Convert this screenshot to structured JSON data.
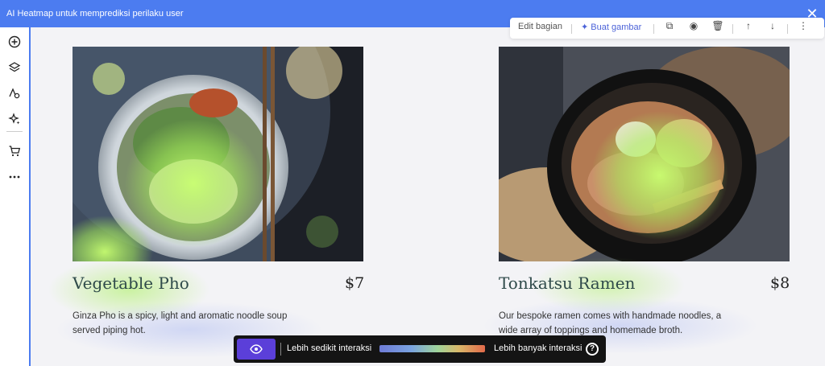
{
  "topbar": {
    "title": "AI Heatmap untuk memprediksi perilaku user",
    "close_icon": "close-icon"
  },
  "sidebar": {
    "icons": [
      "add-circle-icon",
      "layers-icon",
      "text-style-icon",
      "sparkle-icon",
      "cart-icon",
      "more-icon"
    ]
  },
  "toolbar": {
    "edit_label": "Edit bagian",
    "ai_label": "Buat gambar",
    "icons": [
      "copy-icon",
      "eye-icon",
      "delete-icon",
      "arrow-up-icon",
      "arrow-down-icon",
      "more-vertical-icon"
    ]
  },
  "menu": {
    "items": [
      {
        "title": "Vegetable Pho",
        "price": "$7",
        "description": "Ginza Pho is a spicy, light and aromatic noodle soup served piping hot."
      },
      {
        "title": "Tonkatsu Ramen",
        "price": "$8",
        "description": "Our bespoke ramen comes with handmade noodles, a wide array of toppings and homemade broth."
      }
    ]
  },
  "legend": {
    "low_label": "Lebih sedikit interaksi",
    "high_label": "Lebih banyak interaksi",
    "help_symbol": "?",
    "gradient_colors": [
      "#6e7bd6",
      "#7aa3e0",
      "#9fd49a",
      "#d9b86a",
      "#e26a4a"
    ]
  },
  "colors": {
    "accent": "#4c7cf0",
    "heat_high": "#a8f05a",
    "heat_low": "#8fa2f0",
    "legend_button": "#5b3fd9"
  }
}
